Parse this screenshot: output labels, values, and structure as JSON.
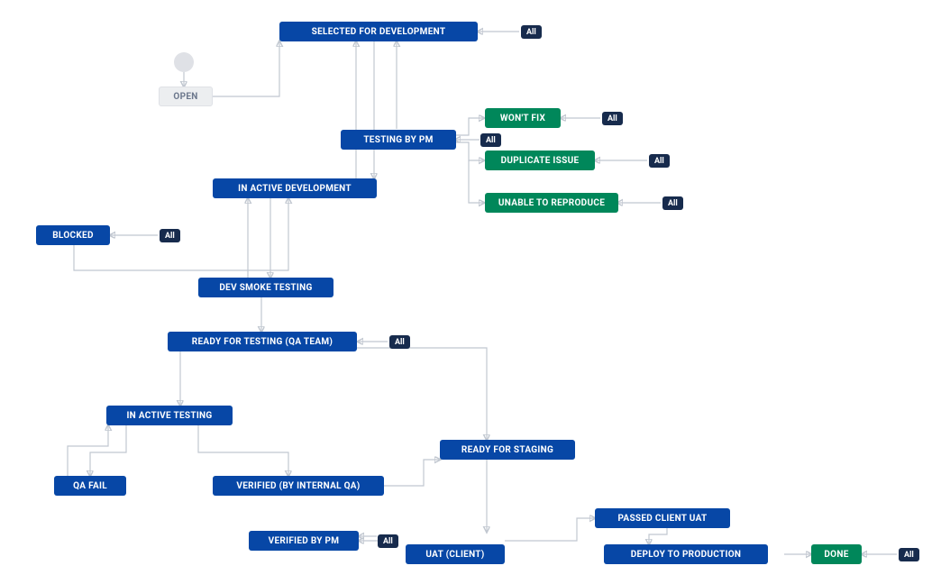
{
  "diagram_type": "workflow",
  "colors": {
    "status_todo": "#0747a6",
    "status_done": "#00875a",
    "status_neutral": "#eceef0",
    "badge": "#172b4d",
    "edge": "#c1c7d0"
  },
  "nodes": {
    "start": {
      "kind": "start"
    },
    "selected_for_development": {
      "label": "SELECTED FOR DEVELOPMENT",
      "kind": "blue",
      "all_badge": true
    },
    "open": {
      "label": "OPEN",
      "kind": "grey",
      "all_badge": false
    },
    "testing_by_pm": {
      "label": "TESTING BY PM",
      "kind": "blue",
      "all_badge": true
    },
    "wont_fix": {
      "label": "WON'T FIX",
      "kind": "green",
      "all_badge": true
    },
    "duplicate_issue": {
      "label": "DUPLICATE ISSUE",
      "kind": "green",
      "all_badge": true
    },
    "unable_to_reproduce": {
      "label": "UNABLE TO REPRODUCE",
      "kind": "green",
      "all_badge": true
    },
    "in_active_development": {
      "label": "IN ACTIVE DEVELOPMENT",
      "kind": "blue",
      "all_badge": false
    },
    "blocked": {
      "label": "BLOCKED",
      "kind": "blue",
      "all_badge": true
    },
    "dev_smoke_testing": {
      "label": "DEV SMOKE TESTING",
      "kind": "blue",
      "all_badge": false
    },
    "ready_for_testing_qa": {
      "label": "READY FOR TESTING (QA TEAM)",
      "kind": "blue",
      "all_badge": true
    },
    "in_active_testing": {
      "label": "IN ACTIVE TESTING",
      "kind": "blue",
      "all_badge": false
    },
    "qa_fail": {
      "label": "QA FAIL",
      "kind": "blue",
      "all_badge": false
    },
    "verified_by_internal_qa": {
      "label": "VERIFIED (BY INTERNAL QA)",
      "kind": "blue",
      "all_badge": false
    },
    "ready_for_staging": {
      "label": "READY FOR STAGING",
      "kind": "blue",
      "all_badge": false
    },
    "passed_client_uat": {
      "label": "PASSED CLIENT UAT",
      "kind": "blue",
      "all_badge": false
    },
    "verified_by_pm": {
      "label": "VERIFIED BY PM",
      "kind": "blue",
      "all_badge": true
    },
    "uat_client": {
      "label": "UAT (CLIENT)",
      "kind": "blue",
      "all_badge": false
    },
    "deploy_to_production": {
      "label": "DEPLOY TO PRODUCTION",
      "kind": "blue",
      "all_badge": false
    },
    "done": {
      "label": "DONE",
      "kind": "green",
      "all_badge": true
    }
  },
  "badge_label": "All",
  "edges": [
    {
      "from": "start",
      "to": "open"
    },
    {
      "from": "open",
      "to": "selected_for_development"
    },
    {
      "from": "selected_for_development",
      "to": "in_active_development"
    },
    {
      "from": "in_active_development",
      "to": "dev_smoke_testing"
    },
    {
      "from": "dev_smoke_testing",
      "to": "ready_for_testing_qa"
    },
    {
      "from": "ready_for_testing_qa",
      "to": "in_active_testing"
    },
    {
      "from": "in_active_testing",
      "to": "qa_fail"
    },
    {
      "from": "in_active_testing",
      "to": "verified_by_internal_qa"
    },
    {
      "from": "verified_by_internal_qa",
      "to": "ready_for_staging"
    },
    {
      "from": "ready_for_staging",
      "to": "uat_client"
    },
    {
      "from": "uat_client",
      "to": "verified_by_pm"
    },
    {
      "from": "uat_client",
      "to": "passed_client_uat"
    },
    {
      "from": "passed_client_uat",
      "to": "deploy_to_production"
    },
    {
      "from": "deploy_to_production",
      "to": "done"
    },
    {
      "from": "testing_by_pm",
      "to": "wont_fix"
    },
    {
      "from": "testing_by_pm",
      "to": "duplicate_issue"
    },
    {
      "from": "testing_by_pm",
      "to": "unable_to_reproduce"
    },
    {
      "from": "blocked",
      "to": "in_active_development"
    },
    {
      "from": "qa_fail",
      "to": "in_active_development"
    }
  ]
}
